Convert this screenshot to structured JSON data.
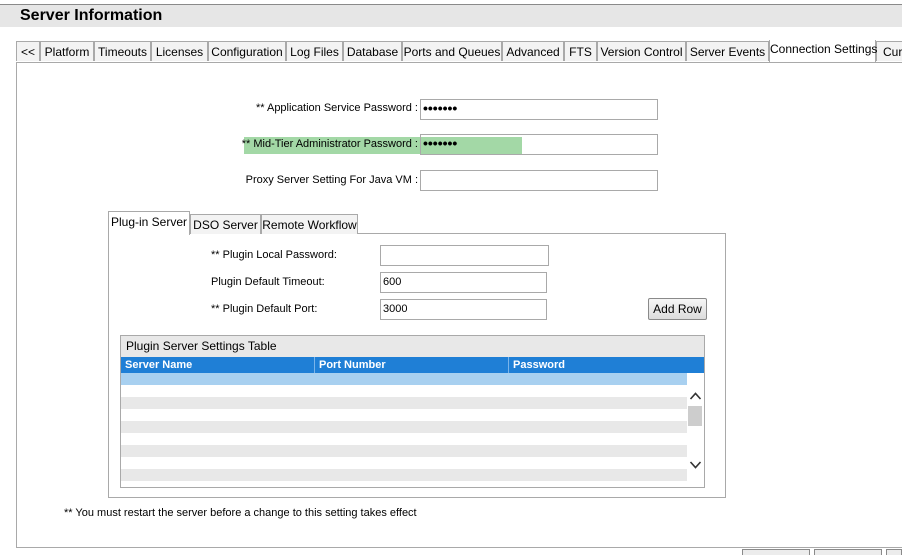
{
  "window": {
    "title": "Server Information"
  },
  "main_tabs": [
    {
      "label": "<<"
    },
    {
      "label": "Platform"
    },
    {
      "label": "Timeouts"
    },
    {
      "label": "Licenses"
    },
    {
      "label": "Configuration"
    },
    {
      "label": "Log Files"
    },
    {
      "label": "Database"
    },
    {
      "label": "Ports and Queues"
    },
    {
      "label": "Advanced"
    },
    {
      "label": "FTS"
    },
    {
      "label": "Version Control"
    },
    {
      "label": "Server Events"
    },
    {
      "label": "Connection Settings",
      "active": true
    },
    {
      "label": "Cur"
    }
  ],
  "connection": {
    "app_service_password": {
      "label": "** Application Service Password :",
      "value": "•••••••"
    },
    "midtier_admin_password": {
      "label": "** Mid-Tier Administrator Password :",
      "value": "•••••••",
      "highlight_color": "#a3d8a6"
    },
    "proxy_server_setting": {
      "label": "Proxy Server Setting For Java VM :",
      "value": ""
    }
  },
  "sub_tabs": [
    {
      "label": "Plug-in Server",
      "active": true
    },
    {
      "label": "DSO Server"
    },
    {
      "label": "Remote Workflow"
    }
  ],
  "plugin": {
    "local_password": {
      "label": "** Plugin Local Password:",
      "value": ""
    },
    "default_timeout": {
      "label": "Plugin Default Timeout:",
      "value": "600"
    },
    "default_port": {
      "label": "** Plugin Default Port:",
      "value": "3000"
    },
    "add_row_label": "Add Row"
  },
  "table": {
    "caption": "Plugin Server Settings Table",
    "columns": [
      "Server Name",
      "Port Number",
      "Password"
    ],
    "rows": []
  },
  "footnote": "** You must restart the server before a change to this setting takes effect",
  "colors": {
    "accent": "#1f7fd6",
    "selected_row": "#a8d0f0",
    "highlight": "#a3d8a6"
  }
}
